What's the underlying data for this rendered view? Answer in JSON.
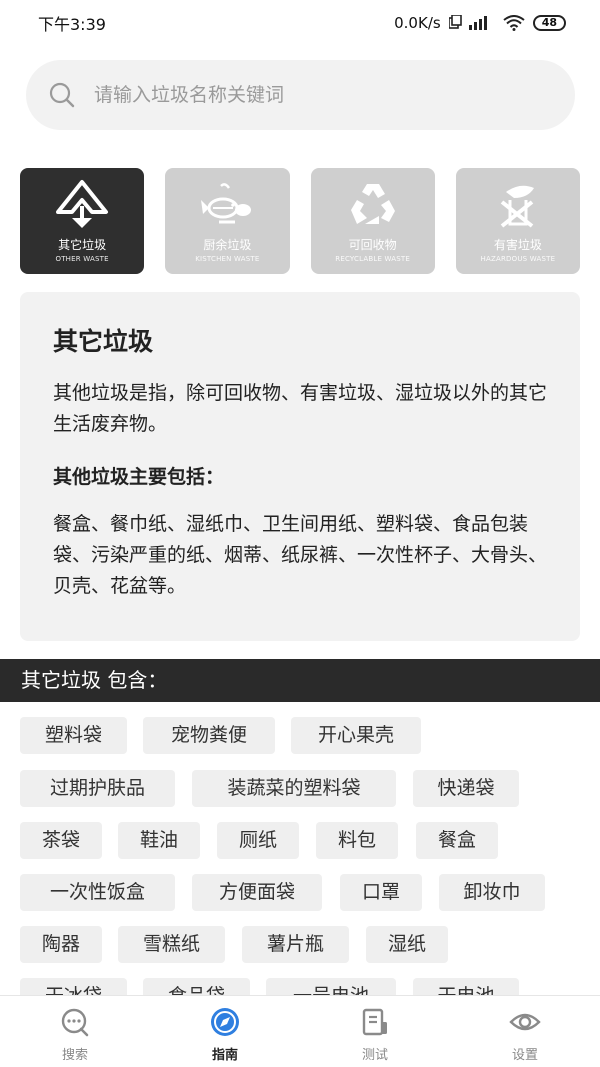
{
  "status_bar": {
    "time": "下午3:39",
    "network": "0.0K/s",
    "battery": "48"
  },
  "search": {
    "placeholder": "请输入垃圾名称关键词",
    "icon": "search-icon"
  },
  "categories": [
    {
      "name": "其它垃圾",
      "en": "OTHER WASTE",
      "active": true,
      "icon": "other-waste-icon"
    },
    {
      "name": "厨余垃圾",
      "en": "KISTCHEN WASTE",
      "active": false,
      "icon": "kitchen-waste-icon"
    },
    {
      "name": "可回收物",
      "en": "RECYCLABLE WASTE",
      "active": false,
      "icon": "recycle-icon"
    },
    {
      "name": "有害垃圾",
      "en": "HAZARDOUS WASTE",
      "active": false,
      "icon": "hazardous-icon"
    }
  ],
  "info": {
    "title": "其它垃圾",
    "description": "其他垃圾是指，除可回收物、有害垃圾、湿垃圾以外的其它生活废弃物。",
    "includes_title": "其他垃圾主要包括：",
    "includes": "餐盒、餐巾纸、湿纸巾、卫生间用纸、塑料袋、食品包装袋、污染严重的纸、烟蒂、纸尿裤、一次性杯子、大骨头、贝壳、花盆等。"
  },
  "section_title": "其它垃圾  包含：",
  "tags": [
    "塑料袋",
    "宠物粪便",
    "开心果壳",
    "过期护肤品",
    "装蔬菜的塑料袋",
    "快递袋",
    "茶袋",
    "鞋油",
    "厕纸",
    "料包",
    "餐盒",
    "一次性饭盒",
    "方便面袋",
    "口罩",
    "卸妆巾",
    "陶器",
    "雪糕纸",
    "薯片瓶",
    "湿纸",
    "干冰袋",
    "食品袋",
    "一号电池",
    "干电池"
  ],
  "nav": [
    {
      "label": "搜索",
      "icon": "chat-search-icon",
      "active": false
    },
    {
      "label": "指南",
      "icon": "compass-icon",
      "active": true
    },
    {
      "label": "测试",
      "icon": "test-doc-icon",
      "active": false
    },
    {
      "label": "设置",
      "icon": "settings-eye-icon",
      "active": false
    }
  ],
  "colors": {
    "active_category": "#2f2f2f",
    "inactive_category": "#cfcfcf",
    "section_bar": "#2a2a2a",
    "accent_blue": "#2f7fe0"
  }
}
